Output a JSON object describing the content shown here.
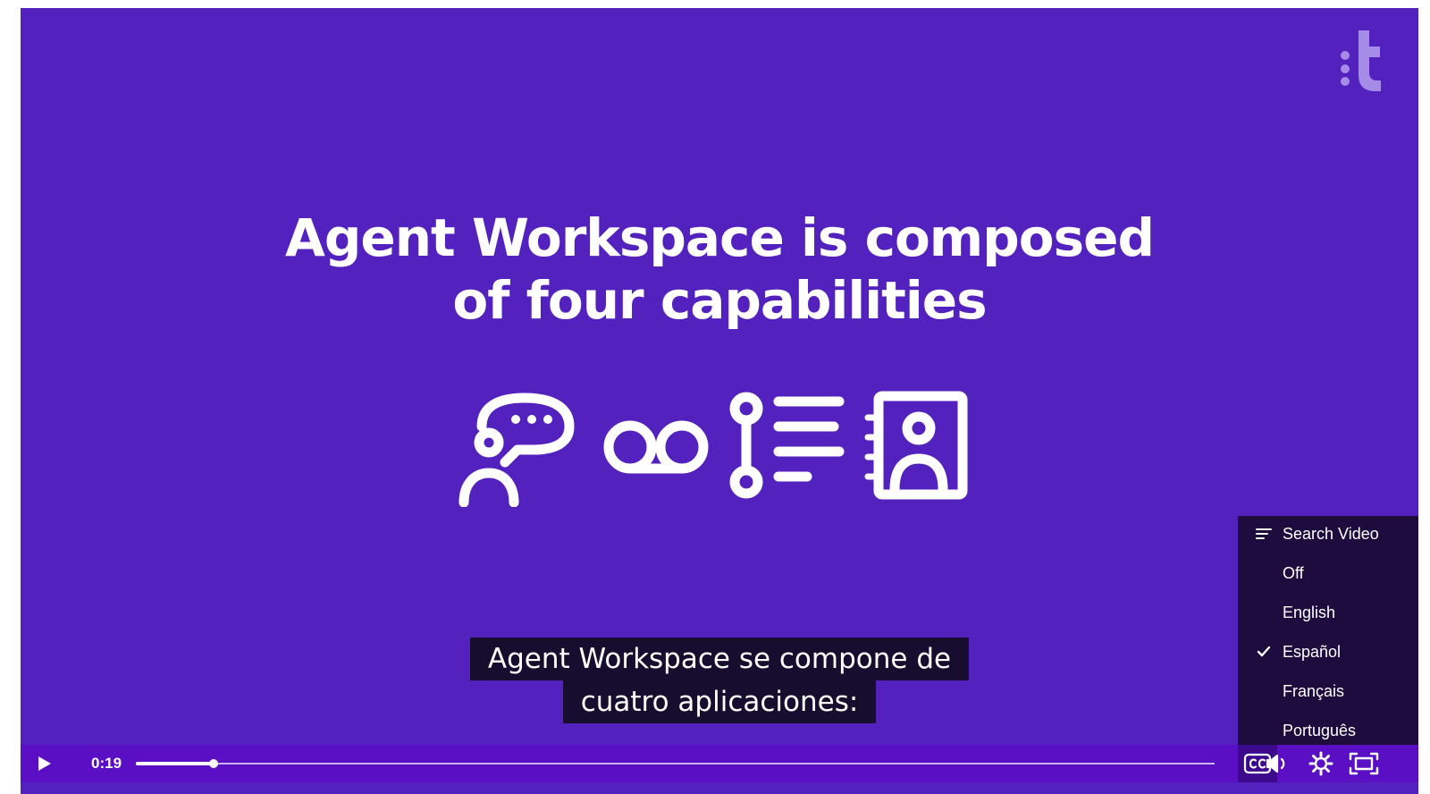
{
  "slide": {
    "headline_line1": "Agent Workspace is composed",
    "headline_line2": "of four capabilities",
    "icons": [
      "agent-chat-icon",
      "voicemail-icon",
      "workflow-list-icon",
      "contact-book-icon"
    ],
    "background_color": "#5321be"
  },
  "brand": {
    "logo_icon": "twilio-t-logo",
    "logo_color": "#a58ce6"
  },
  "captions": {
    "line1": "Agent Workspace se compone de",
    "line2": "cuatro aplicaciones:"
  },
  "cc_menu": {
    "search_label": "Search Video",
    "options": [
      {
        "label": "Off",
        "selected": false
      },
      {
        "label": "English",
        "selected": false
      },
      {
        "label": "Español",
        "selected": true
      },
      {
        "label": "Français",
        "selected": false
      },
      {
        "label": "Português",
        "selected": false
      }
    ]
  },
  "controls": {
    "current_time": "0:19",
    "progress_fraction": 0.072,
    "bar_color": "#5a0fc4",
    "buttons": [
      "play-icon",
      "closed-captions-icon",
      "volume-icon",
      "settings-gear-icon",
      "fullscreen-icon"
    ]
  }
}
